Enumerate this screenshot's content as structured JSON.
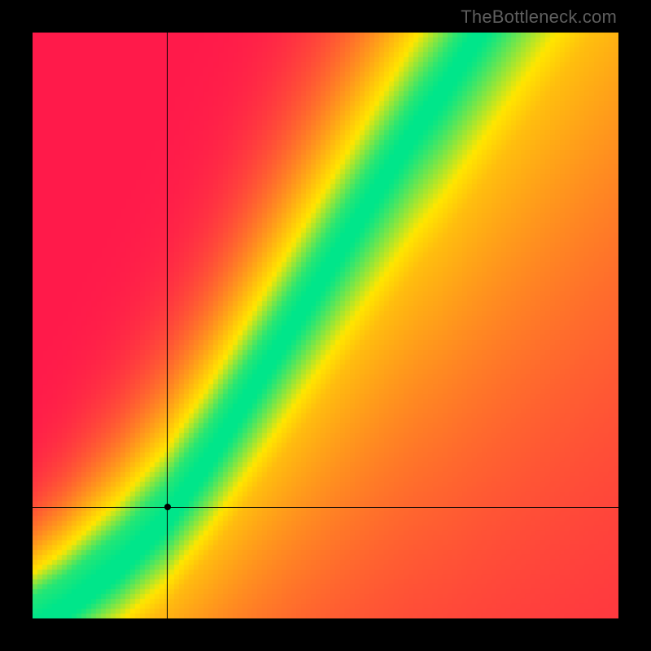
{
  "watermark": "TheBottleneck.com",
  "chart_data": {
    "type": "heatmap",
    "title": "",
    "xlabel": "",
    "ylabel": "",
    "xlim": [
      0,
      1
    ],
    "ylim": [
      0,
      1
    ],
    "grid": false,
    "legend": false,
    "color_scale": {
      "low": "#ff1a4b",
      "mid": "#ffe600",
      "optimal": "#00e68a",
      "description": "value 1 = optimal match (green), 0 = worst (red)"
    },
    "optimal_curve": {
      "description": "green band follows y ≈ f(x); points are (x, y_optimal) in normalized [0,1] axes, origin bottom-left",
      "points": [
        [
          0.0,
          0.0
        ],
        [
          0.05,
          0.03
        ],
        [
          0.1,
          0.07
        ],
        [
          0.15,
          0.11
        ],
        [
          0.2,
          0.16
        ],
        [
          0.23,
          0.19
        ],
        [
          0.25,
          0.22
        ],
        [
          0.3,
          0.29
        ],
        [
          0.35,
          0.37
        ],
        [
          0.4,
          0.45
        ],
        [
          0.45,
          0.53
        ],
        [
          0.5,
          0.61
        ],
        [
          0.55,
          0.69
        ],
        [
          0.6,
          0.77
        ],
        [
          0.65,
          0.85
        ],
        [
          0.7,
          0.92
        ],
        [
          0.75,
          1.0
        ]
      ]
    },
    "optimal_band_halfwidth": 0.035,
    "crosshair": {
      "x": 0.23,
      "y": 0.19
    },
    "marker": {
      "x": 0.23,
      "y": 0.19
    }
  }
}
